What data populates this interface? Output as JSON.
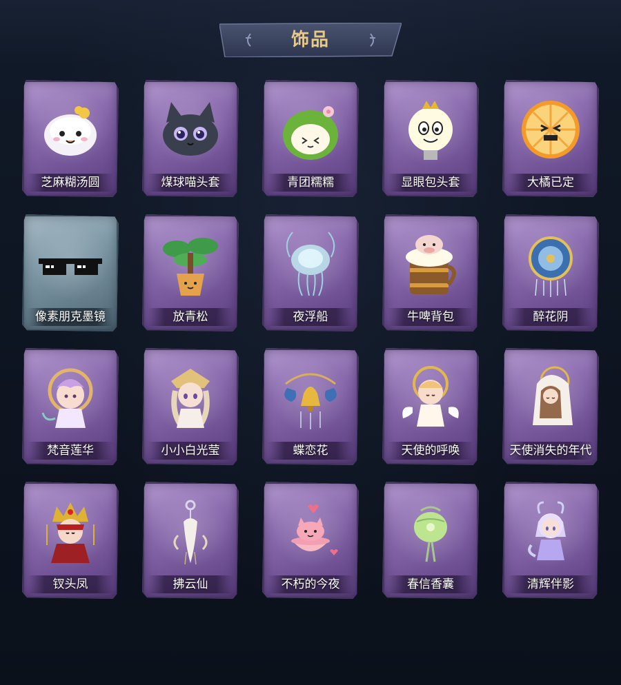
{
  "header": {
    "title": "饰品"
  },
  "items": [
    {
      "name": "芝麻糊汤圆",
      "icon": "dumpling-icon"
    },
    {
      "name": "煤球喵头套",
      "icon": "black-cat-head-icon"
    },
    {
      "name": "青团糯糯",
      "icon": "green-rice-ball-icon"
    },
    {
      "name": "显眼包头套",
      "icon": "lightbulb-head-icon"
    },
    {
      "name": "大橘已定",
      "icon": "orange-slice-icon"
    },
    {
      "name": "像素朋克墨镜",
      "icon": "pixel-sunglasses-icon"
    },
    {
      "name": "放青松",
      "icon": "bonsai-pine-icon"
    },
    {
      "name": "夜浮船",
      "icon": "jellyfish-icon"
    },
    {
      "name": "牛啤背包",
      "icon": "beer-mug-cow-icon"
    },
    {
      "name": "醉花阴",
      "icon": "ornate-fan-icon"
    },
    {
      "name": "梵音莲华",
      "icon": "lotus-chibi-icon"
    },
    {
      "name": "小小白光莹",
      "icon": "white-light-chibi-icon"
    },
    {
      "name": "蝶恋花",
      "icon": "butterfly-bell-icon"
    },
    {
      "name": "天使的呼唤",
      "icon": "angel-chibi-icon"
    },
    {
      "name": "天使消失的年代",
      "icon": "veiled-angel-chibi-icon"
    },
    {
      "name": "钗头凤",
      "icon": "phoenix-crown-chibi-icon"
    },
    {
      "name": "拂云仙",
      "icon": "cloud-fairy-charm-icon"
    },
    {
      "name": "不朽的今夜",
      "icon": "pink-cat-bowl-icon"
    },
    {
      "name": "春信香囊",
      "icon": "green-sachet-icon"
    },
    {
      "name": "清辉伴影",
      "icon": "white-dragon-chibi-icon"
    }
  ]
}
